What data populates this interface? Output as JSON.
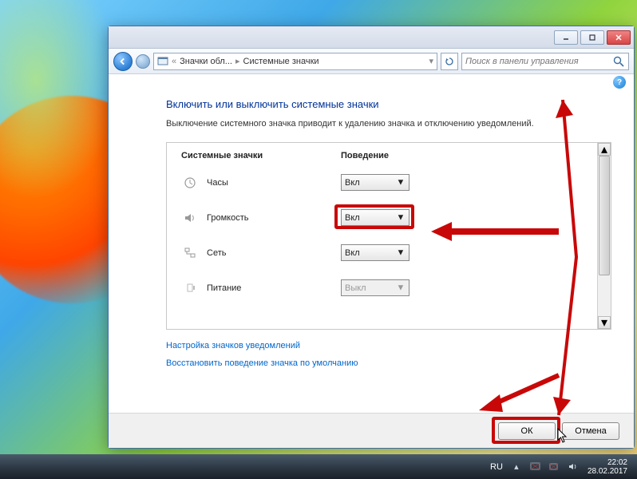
{
  "address": {
    "crumb1": "Значки обл...",
    "crumb2": "Системные значки"
  },
  "search": {
    "placeholder": "Поиск в панели управления"
  },
  "heading": "Включить или выключить системные значки",
  "description": "Выключение системного значка приводит к удалению значка и отключению уведомлений.",
  "table": {
    "col1": "Системные значки",
    "col2": "Поведение",
    "rows": [
      {
        "label": "Часы",
        "value": "Вкл",
        "disabled": false,
        "icon": "clock"
      },
      {
        "label": "Громкость",
        "value": "Вкл",
        "disabled": false,
        "icon": "volume",
        "highlighted": true
      },
      {
        "label": "Сеть",
        "value": "Вкл",
        "disabled": false,
        "icon": "network"
      },
      {
        "label": "Питание",
        "value": "Выкл",
        "disabled": true,
        "icon": "power"
      }
    ]
  },
  "links": {
    "a": "Настройка значков уведомлений",
    "b": "Восстановить поведение значка по умолчанию"
  },
  "buttons": {
    "ok": "ОК",
    "cancel": "Отмена"
  },
  "tray": {
    "lang": "RU",
    "time": "22:02",
    "date": "28.02.2017"
  }
}
